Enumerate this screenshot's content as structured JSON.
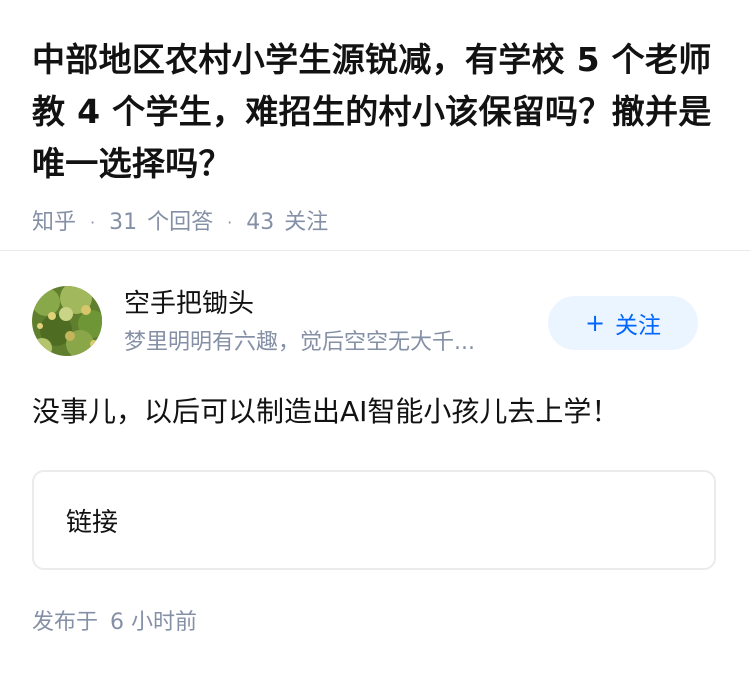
{
  "question": {
    "title": "中部地区农村小学生源锐减，有学校 5 个老师教 4 个学生，难招生的村小该保留吗？撤并是唯一选择吗？",
    "source": "知乎",
    "answers_count": "31",
    "answers_label": "个回答",
    "follows_count": "43",
    "follows_label": "关注"
  },
  "author": {
    "name": "空手把锄头",
    "bio": "梦里明明有六趣，觉后空空无大千...",
    "follow_plus": "+",
    "follow_label": "关注"
  },
  "answer": {
    "text": "没事儿，以后可以制造出AI智能小孩儿去上学！",
    "link_label": "链接",
    "published_label": "发布于",
    "published_time": "6 小时前"
  },
  "colors": {
    "accent": "#0066ff",
    "follow_bg": "#ebf5ff",
    "meta_gray": "#8590a6"
  }
}
